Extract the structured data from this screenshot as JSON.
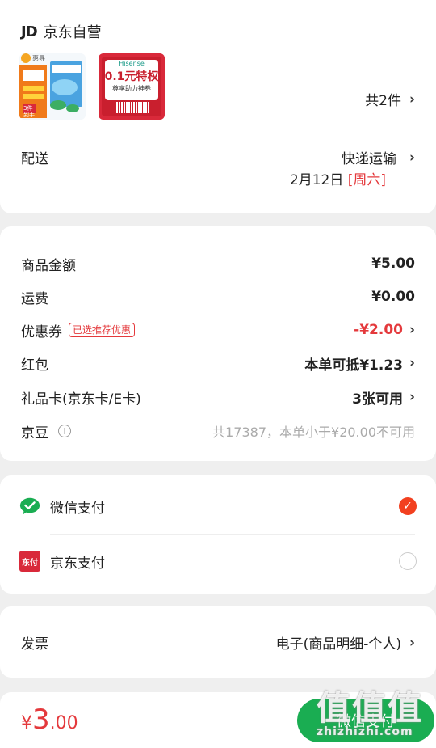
{
  "order": {
    "jd_logo": "JD",
    "store_name": "京东自营",
    "thumb1_brand": "惠寻",
    "thumb1_text": "3件到手",
    "thumb2_brand": "Hisense",
    "thumb2_title": "0.1元特权",
    "thumb2_sub": "尊享助力神券",
    "item_count": "共2件",
    "delivery_label": "配送",
    "delivery_method": "快递运输",
    "delivery_date": "2月12日",
    "delivery_weekday": "[周六]"
  },
  "price": {
    "goods_label": "商品金额",
    "goods_value": "¥5.00",
    "shipping_label": "运费",
    "shipping_value": "¥0.00",
    "coupon_label": "优惠券",
    "coupon_badge": "已选推荐优惠",
    "coupon_value": "-¥2.00",
    "redpacket_label": "红包",
    "redpacket_value": "本单可抵¥1.23",
    "giftcard_label": "礼品卡(京东卡/E卡)",
    "giftcard_value": "3张可用",
    "jingdou_label": "京豆",
    "jingdou_info": "i",
    "jingdou_value": "共17387，本单小于¥20.00不可用"
  },
  "payment": {
    "wechat_label": "微信支付",
    "jd_pay_label": "京东支付",
    "jd_pay_icon_text": "东付",
    "selected": "wechat"
  },
  "invoice": {
    "label": "发票",
    "value": "电子(商品明细-个人)"
  },
  "bottom": {
    "currency": "¥",
    "total_int": "3",
    "total_dec": ".00",
    "pay_button": "微信支付"
  },
  "watermark": {
    "big": "值值值",
    "small": "zhizhizhi.com"
  },
  "colors": {
    "accent_red": "#e4393c",
    "wechat_green": "#1aad52",
    "radio_on": "#f2401f"
  }
}
